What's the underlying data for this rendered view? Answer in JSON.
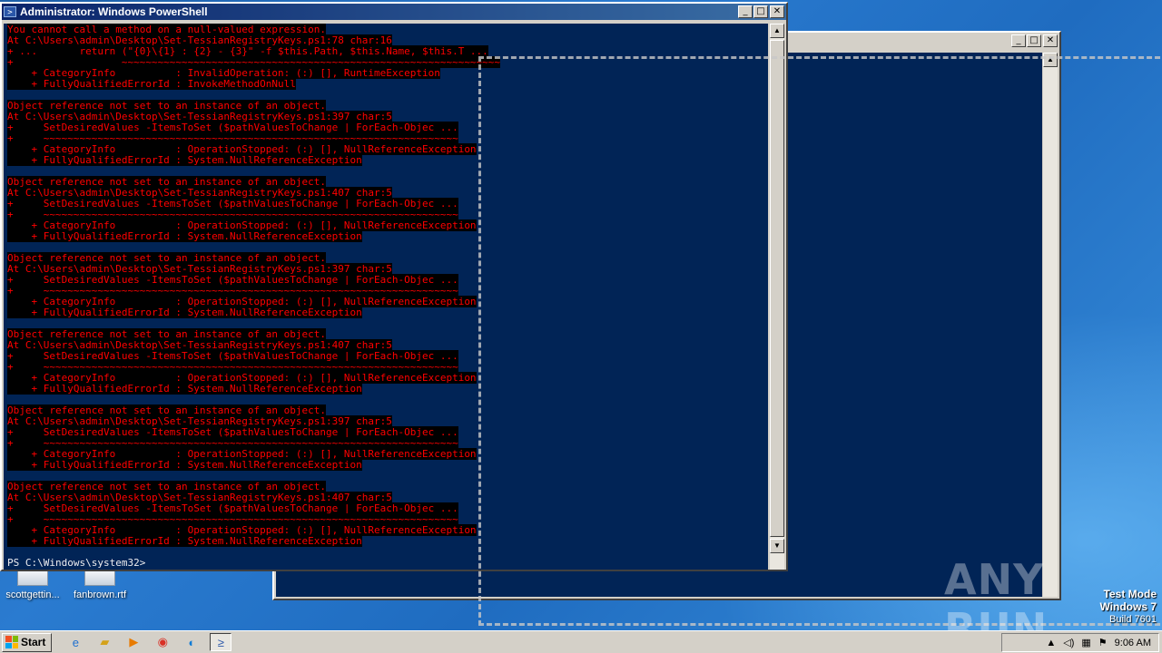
{
  "ps_window": {
    "title": "Administrator: Windows PowerShell",
    "console_lines": [
      {
        "t": "You cannot call a method on a null-valued expression.",
        "k": "err"
      },
      {
        "t": "At C:\\Users\\admin\\Desktop\\Set-TessianRegistryKeys.ps1:78 char:16",
        "k": "err"
      },
      {
        "t": "+ ...       return (\"{0}\\{1} : {2} - {3}\" -f $this.Path, $this.Name, $this.T ...",
        "k": "err"
      },
      {
        "t": "+                  ~~~~~~~~~~~~~~~~~~~~~~~~~~~~~~~~~~~~~~~~~~~~~~~~~~~~~~~~~~~~~~~",
        "k": "err"
      },
      {
        "t": "    + CategoryInfo          : InvalidOperation: (:) [], RuntimeException",
        "k": "err"
      },
      {
        "t": "    + FullyQualifiedErrorId : InvokeMethodOnNull",
        "k": "err"
      },
      {
        "t": "",
        "k": "norm"
      },
      {
        "t": "Object reference not set to an instance of an object.",
        "k": "err"
      },
      {
        "t": "At C:\\Users\\admin\\Desktop\\Set-TessianRegistryKeys.ps1:397 char:5",
        "k": "err"
      },
      {
        "t": "+     SetDesiredValues -ItemsToSet ($pathValuesToChange | ForEach-Objec ...",
        "k": "err"
      },
      {
        "t": "+     ~~~~~~~~~~~~~~~~~~~~~~~~~~~~~~~~~~~~~~~~~~~~~~~~~~~~~~~~~~~~~~~~~~~~~",
        "k": "err"
      },
      {
        "t": "    + CategoryInfo          : OperationStopped: (:) [], NullReferenceException",
        "k": "err"
      },
      {
        "t": "    + FullyQualifiedErrorId : System.NullReferenceException",
        "k": "err"
      },
      {
        "t": "",
        "k": "norm"
      },
      {
        "t": "Object reference not set to an instance of an object.",
        "k": "err"
      },
      {
        "t": "At C:\\Users\\admin\\Desktop\\Set-TessianRegistryKeys.ps1:407 char:5",
        "k": "err"
      },
      {
        "t": "+     SetDesiredValues -ItemsToSet ($pathValuesToChange | ForEach-Objec ...",
        "k": "err"
      },
      {
        "t": "+     ~~~~~~~~~~~~~~~~~~~~~~~~~~~~~~~~~~~~~~~~~~~~~~~~~~~~~~~~~~~~~~~~~~~~~",
        "k": "err"
      },
      {
        "t": "    + CategoryInfo          : OperationStopped: (:) [], NullReferenceException",
        "k": "err"
      },
      {
        "t": "    + FullyQualifiedErrorId : System.NullReferenceException",
        "k": "err"
      },
      {
        "t": "",
        "k": "norm"
      },
      {
        "t": "Object reference not set to an instance of an object.",
        "k": "err"
      },
      {
        "t": "At C:\\Users\\admin\\Desktop\\Set-TessianRegistryKeys.ps1:397 char:5",
        "k": "err"
      },
      {
        "t": "+     SetDesiredValues -ItemsToSet ($pathValuesToChange | ForEach-Objec ...",
        "k": "err"
      },
      {
        "t": "+     ~~~~~~~~~~~~~~~~~~~~~~~~~~~~~~~~~~~~~~~~~~~~~~~~~~~~~~~~~~~~~~~~~~~~~",
        "k": "err"
      },
      {
        "t": "    + CategoryInfo          : OperationStopped: (:) [], NullReferenceException",
        "k": "err"
      },
      {
        "t": "    + FullyQualifiedErrorId : System.NullReferenceException",
        "k": "err"
      },
      {
        "t": "",
        "k": "norm"
      },
      {
        "t": "Object reference not set to an instance of an object.",
        "k": "err"
      },
      {
        "t": "At C:\\Users\\admin\\Desktop\\Set-TessianRegistryKeys.ps1:407 char:5",
        "k": "err"
      },
      {
        "t": "+     SetDesiredValues -ItemsToSet ($pathValuesToChange | ForEach-Objec ...",
        "k": "err"
      },
      {
        "t": "+     ~~~~~~~~~~~~~~~~~~~~~~~~~~~~~~~~~~~~~~~~~~~~~~~~~~~~~~~~~~~~~~~~~~~~~",
        "k": "err"
      },
      {
        "t": "    + CategoryInfo          : OperationStopped: (:) [], NullReferenceException",
        "k": "err"
      },
      {
        "t": "    + FullyQualifiedErrorId : System.NullReferenceException",
        "k": "err"
      },
      {
        "t": "",
        "k": "norm"
      },
      {
        "t": "Object reference not set to an instance of an object.",
        "k": "err"
      },
      {
        "t": "At C:\\Users\\admin\\Desktop\\Set-TessianRegistryKeys.ps1:397 char:5",
        "k": "err"
      },
      {
        "t": "+     SetDesiredValues -ItemsToSet ($pathValuesToChange | ForEach-Objec ...",
        "k": "err"
      },
      {
        "t": "+     ~~~~~~~~~~~~~~~~~~~~~~~~~~~~~~~~~~~~~~~~~~~~~~~~~~~~~~~~~~~~~~~~~~~~~",
        "k": "err"
      },
      {
        "t": "    + CategoryInfo          : OperationStopped: (:) [], NullReferenceException",
        "k": "err"
      },
      {
        "t": "    + FullyQualifiedErrorId : System.NullReferenceException",
        "k": "err"
      },
      {
        "t": "",
        "k": "norm"
      },
      {
        "t": "Object reference not set to an instance of an object.",
        "k": "err"
      },
      {
        "t": "At C:\\Users\\admin\\Desktop\\Set-TessianRegistryKeys.ps1:407 char:5",
        "k": "err"
      },
      {
        "t": "+     SetDesiredValues -ItemsToSet ($pathValuesToChange | ForEach-Objec ...",
        "k": "err"
      },
      {
        "t": "+     ~~~~~~~~~~~~~~~~~~~~~~~~~~~~~~~~~~~~~~~~~~~~~~~~~~~~~~~~~~~~~~~~~~~~~",
        "k": "err"
      },
      {
        "t": "    + CategoryInfo          : OperationStopped: (:) [], NullReferenceException",
        "k": "err"
      },
      {
        "t": "    + FullyQualifiedErrorId : System.NullReferenceException",
        "k": "err"
      },
      {
        "t": "",
        "k": "norm"
      },
      {
        "t": "PS C:\\Windows\\system32>",
        "k": "norm"
      }
    ]
  },
  "desktop": {
    "icons": [
      {
        "label": "scottgettin..."
      },
      {
        "label": "fanbrown.rtf"
      }
    ],
    "watermark": "ANY RUN",
    "test_mode": {
      "line1": "Test Mode",
      "line2": "Windows 7",
      "line3": "Build 7601"
    }
  },
  "taskbar": {
    "start_label": "Start",
    "clock": "9:06 AM"
  },
  "colors": {
    "console_bg": "#012456",
    "error_fg": "#ff0000",
    "error_bg": "#000000",
    "titlebar_active": "#0a246a"
  }
}
